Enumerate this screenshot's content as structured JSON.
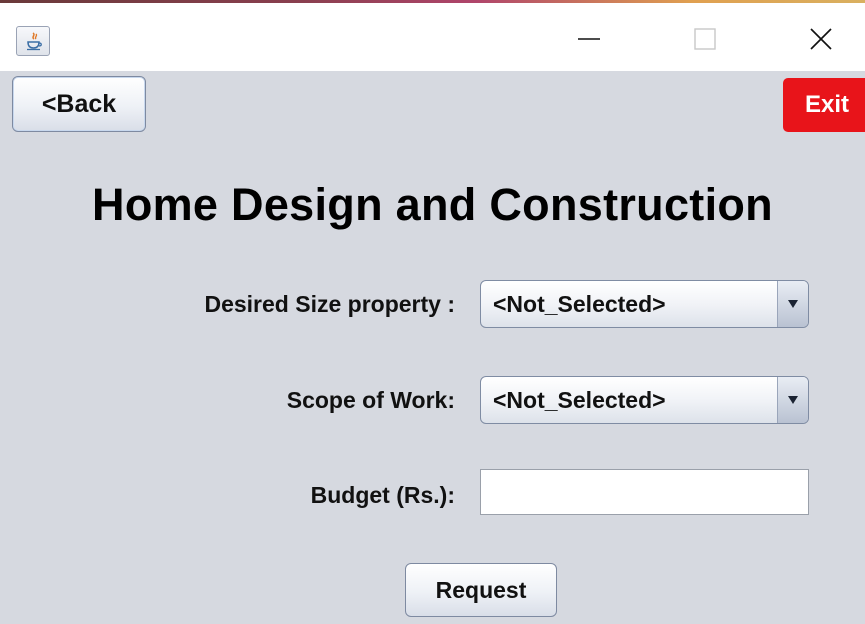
{
  "window": {
    "icon": "java-icon",
    "controls": {
      "minimize_icon": "minimize-icon",
      "maximize_icon": "maximize-icon",
      "close_icon": "close-icon"
    }
  },
  "toolbar": {
    "back_label": "<Back",
    "exit_label": "Exit",
    "exit_color": "#e8141a"
  },
  "page": {
    "title": "Home Design and Construction"
  },
  "form": {
    "size": {
      "label": "Desired Size property :",
      "selected": "<Not_Selected>"
    },
    "scope": {
      "label": "Scope of Work:",
      "selected": "<Not_Selected>"
    },
    "budget": {
      "label": "Budget (Rs.):",
      "value": ""
    },
    "request_label": "Request"
  }
}
